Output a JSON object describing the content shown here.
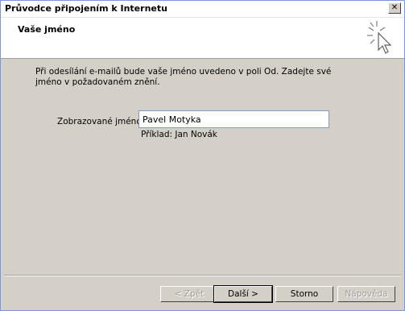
{
  "window": {
    "title": "Průvodce připojením k Internetu",
    "close_glyph": "✕"
  },
  "header": {
    "title": "Vaše jméno",
    "icon": "wizard-sparkle-cursor-icon"
  },
  "main": {
    "description": "Při odesílání e-mailů bude vaše jméno uvedeno v poli Od. Zadejte své jméno v požadovaném znění.",
    "display_name_label": "Zobrazované jméno:",
    "display_name_value": "Pavel Motyka",
    "example_text": "Příklad: Jan Novák"
  },
  "buttons": {
    "back": "< Zpět",
    "next": "Další >",
    "cancel": "Storno",
    "help": "Nápověda"
  },
  "colors": {
    "dialog_bg": "#d4d0c8",
    "header_bg": "#ffffff",
    "input_border": "#7f9db9"
  }
}
